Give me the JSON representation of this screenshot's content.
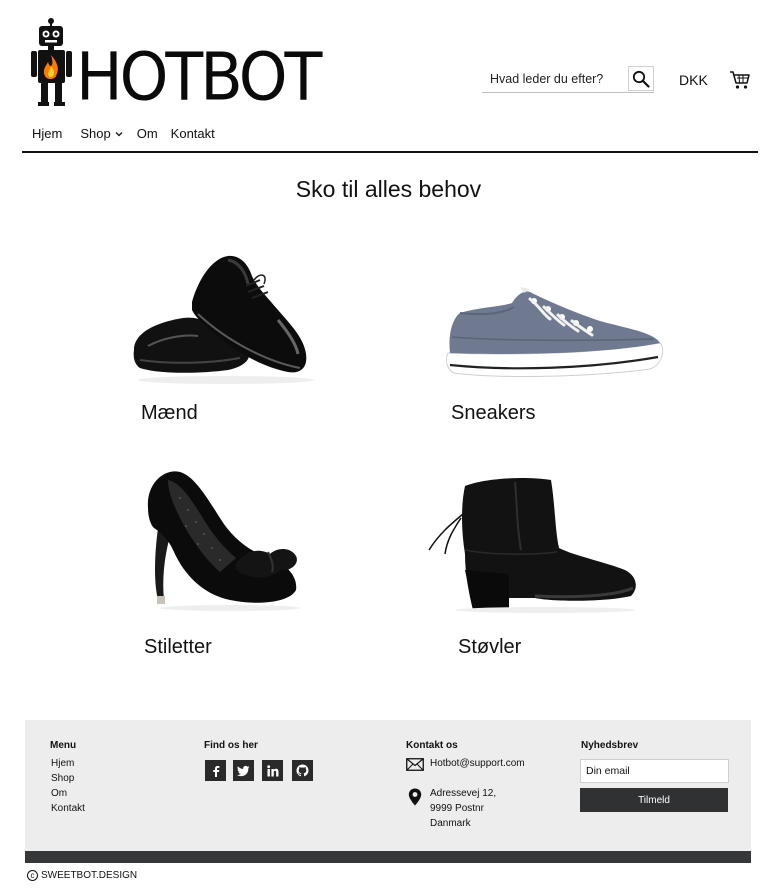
{
  "header": {
    "brand": "HOTBOT",
    "search_placeholder": "Hvad leder du efter?",
    "currency": "DKK",
    "nav": [
      {
        "label": "Hjem"
      },
      {
        "label": "Shop"
      },
      {
        "label": "Om"
      },
      {
        "label": "Kontakt"
      }
    ]
  },
  "main": {
    "title": "Sko til alles behov",
    "categories": [
      {
        "label": "Mænd"
      },
      {
        "label": "Sneakers"
      },
      {
        "label": "Stiletter"
      },
      {
        "label": "Støvler"
      }
    ]
  },
  "footer": {
    "menu": {
      "heading": "Menu",
      "links": [
        "Hjem",
        "Shop",
        "Om",
        "Kontakt"
      ]
    },
    "find": {
      "heading": "Find os her",
      "icons": [
        "facebook-icon",
        "twitter-icon",
        "linkedin-icon",
        "github-icon"
      ]
    },
    "contact": {
      "heading": "Kontakt os",
      "email": "Hotbot@support.com",
      "address": [
        "Adressevej 12,",
        "9999 Postnr",
        "Danmark"
      ]
    },
    "newsletter": {
      "heading": "Nyhedsbrev",
      "placeholder": "Din email",
      "button": "Tilmeld"
    },
    "copyright": "SWEETBOT.DESIGN"
  },
  "colors": {
    "flame": "#ff7a00",
    "footer_bg": "#ededed",
    "dark": "#2f3133"
  }
}
